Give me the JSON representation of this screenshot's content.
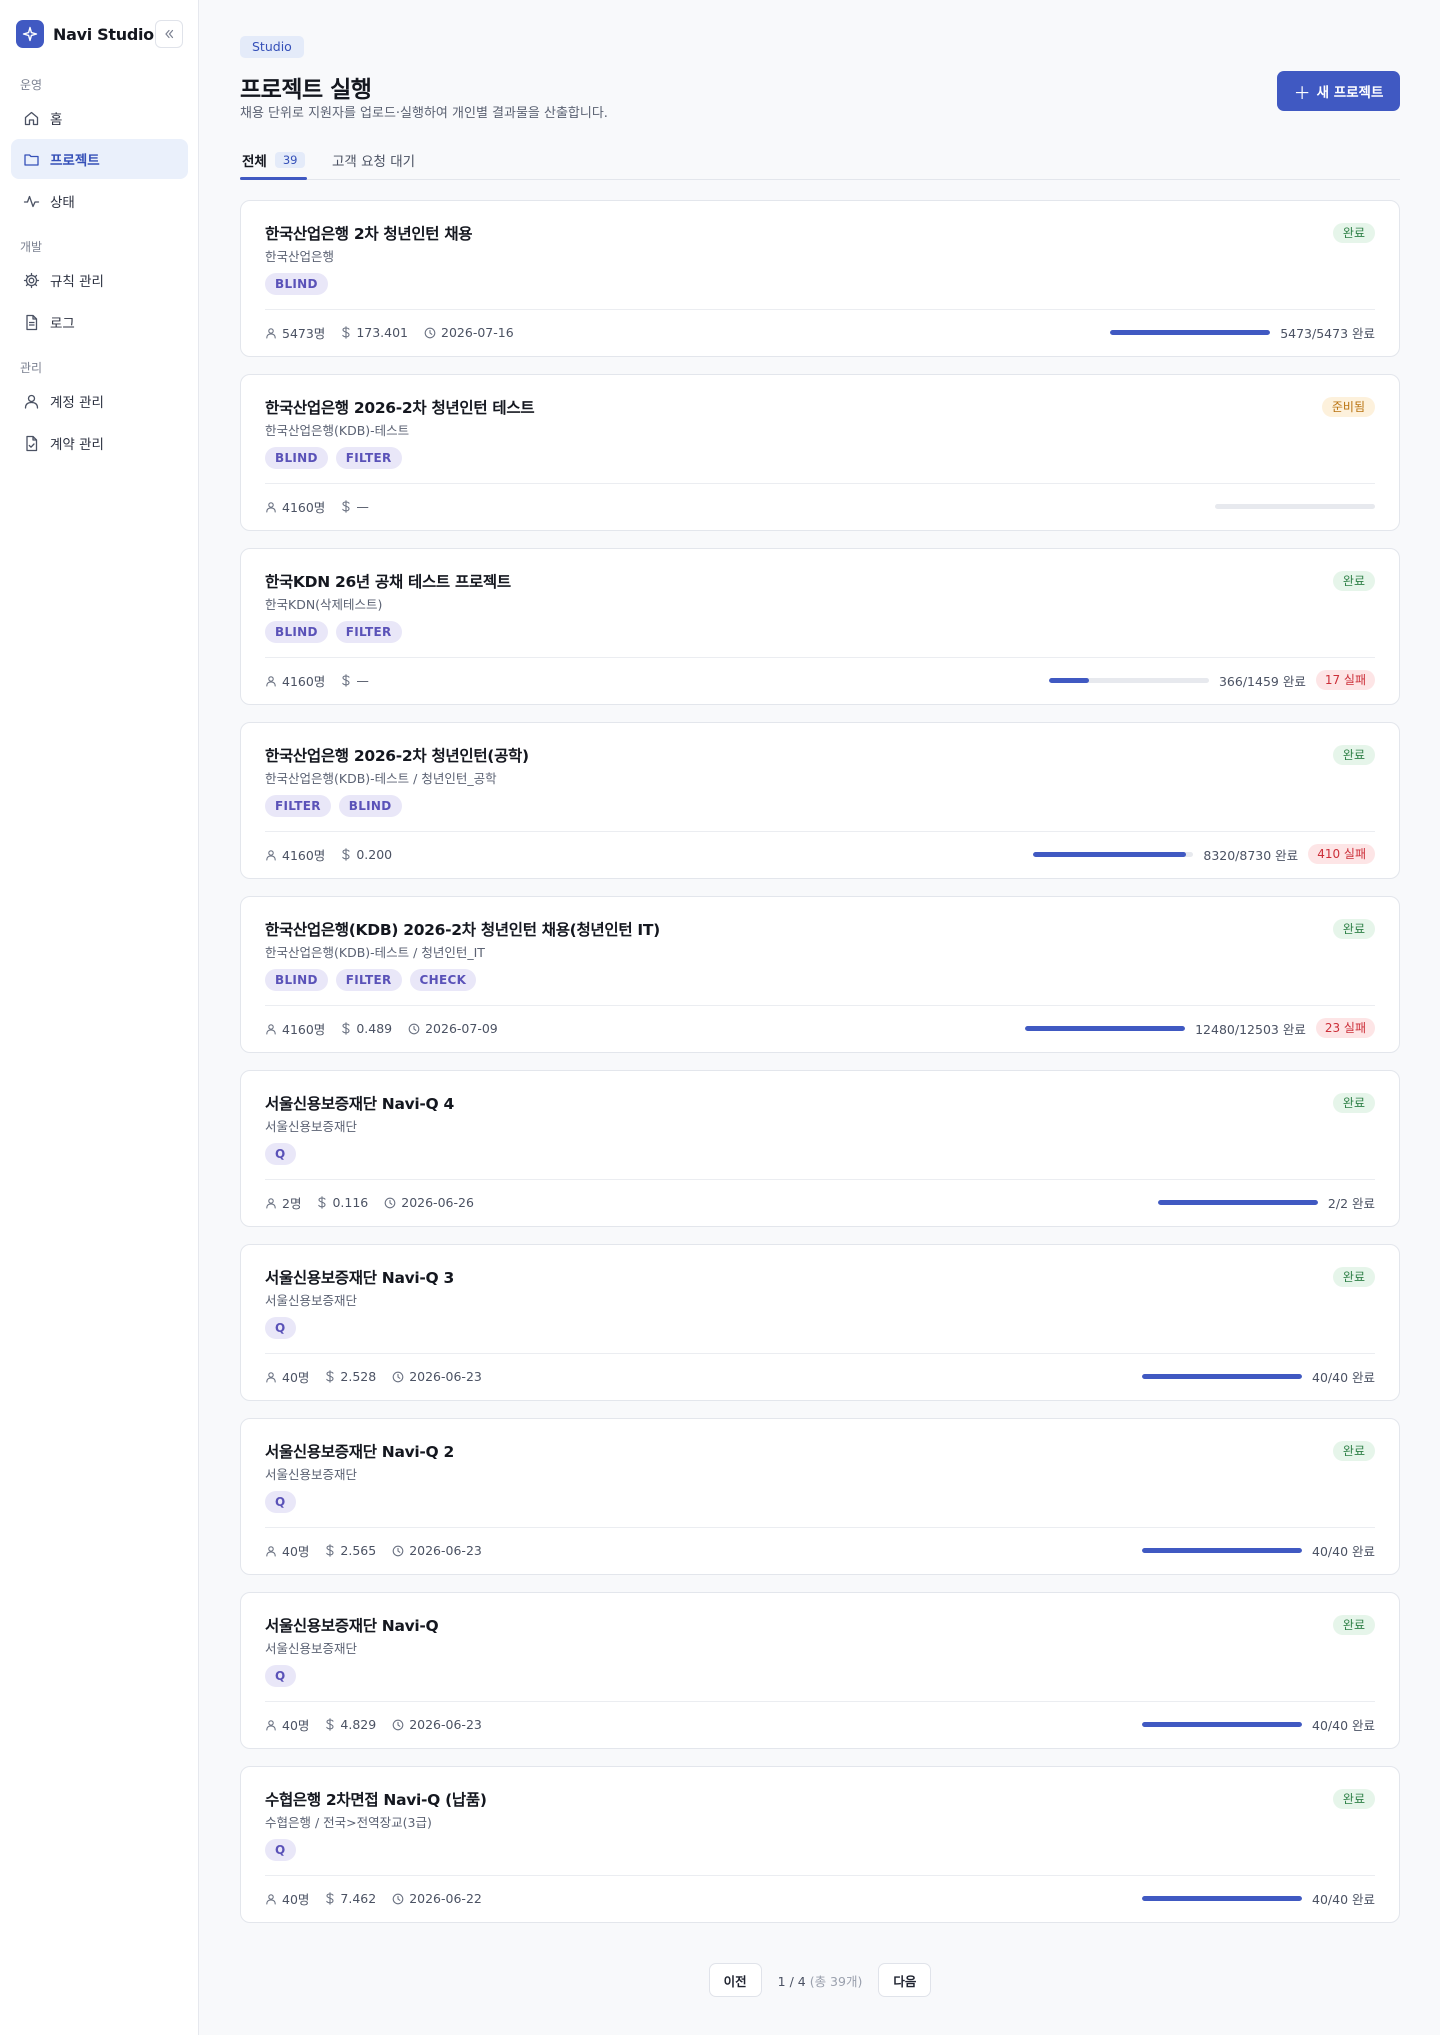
{
  "app": {
    "name": "Navi Studio"
  },
  "sidebar": {
    "sections": [
      {
        "label": "운영",
        "items": [
          {
            "label": "홈",
            "icon": "home-icon",
            "active": false
          },
          {
            "label": "프로젝트",
            "icon": "folder-icon",
            "active": true
          },
          {
            "label": "상태",
            "icon": "activity-icon",
            "active": false
          }
        ]
      },
      {
        "label": "개발",
        "items": [
          {
            "label": "규칙 관리",
            "icon": "gear-icon",
            "active": false
          },
          {
            "label": "로그",
            "icon": "document-icon",
            "active": false
          }
        ]
      },
      {
        "label": "관리",
        "items": [
          {
            "label": "계정 관리",
            "icon": "user-icon",
            "active": false
          },
          {
            "label": "계약 관리",
            "icon": "contract-icon",
            "active": false
          }
        ]
      }
    ]
  },
  "header": {
    "badge": "Studio",
    "title": "프로젝트 실행",
    "subtitle": "채용 단위로 지원자를 업로드·실행하여 개인별 결과물을 산출합니다.",
    "new_button": "새 프로젝트"
  },
  "tabs": [
    {
      "label": "전체",
      "count": "39",
      "active": true
    },
    {
      "label": "고객 요청 대기",
      "active": false
    }
  ],
  "projects": [
    {
      "title": "한국산업은행 2차 청년인턴 채용",
      "org": "한국산업은행",
      "status": "완료",
      "tags": [
        "BLIND"
      ],
      "people": "5473명",
      "cost": "173.401",
      "date": "2026-07-16",
      "progress": 1.0,
      "progress_text": "5473/5473 완료",
      "fail": ""
    },
    {
      "title": "한국산업은행 2026-2차 청년인턴 테스트",
      "org": "한국산업은행(KDB)-테스트",
      "status": "준비됨",
      "tags": [
        "BLIND",
        "FILTER"
      ],
      "people": "4160명",
      "cost": "—",
      "date": "",
      "progress": 0.0,
      "progress_text": "",
      "fail": ""
    },
    {
      "title": "한국KDN 26년 공채 테스트 프로젝트",
      "org": "한국KDN(삭제테스트)",
      "status": "완료",
      "tags": [
        "BLIND",
        "FILTER"
      ],
      "people": "4160명",
      "cost": "—",
      "date": "",
      "progress": 0.25,
      "progress_text": "366/1459 완료",
      "fail": "17 실패"
    },
    {
      "title": "한국산업은행 2026-2차 청년인턴(공학)",
      "org": "한국산업은행(KDB)-테스트 / 청년인턴_공학",
      "status": "완료",
      "tags": [
        "FILTER",
        "BLIND"
      ],
      "people": "4160명",
      "cost": "0.200",
      "date": "",
      "progress": 0.953,
      "progress_text": "8320/8730 완료",
      "fail": "410 실패"
    },
    {
      "title": "한국산업은행(KDB) 2026-2차 청년인턴 채용(청년인턴 IT)",
      "org": "한국산업은행(KDB)-테스트 / 청년인턴_IT",
      "status": "완료",
      "tags": [
        "BLIND",
        "FILTER",
        "CHECK"
      ],
      "people": "4160명",
      "cost": "0.489",
      "date": "2026-07-09",
      "progress": 0.998,
      "progress_text": "12480/12503 완료",
      "fail": "23 실패"
    },
    {
      "title": "서울신용보증재단 Navi-Q 4",
      "org": "서울신용보증재단",
      "status": "완료",
      "tags": [
        "Q"
      ],
      "people": "2명",
      "cost": "0.116",
      "date": "2026-06-26",
      "progress": 1.0,
      "progress_text": "2/2 완료",
      "fail": ""
    },
    {
      "title": "서울신용보증재단 Navi-Q 3",
      "org": "서울신용보증재단",
      "status": "완료",
      "tags": [
        "Q"
      ],
      "people": "40명",
      "cost": "2.528",
      "date": "2026-06-23",
      "progress": 1.0,
      "progress_text": "40/40 완료",
      "fail": ""
    },
    {
      "title": "서울신용보증재단 Navi-Q 2",
      "org": "서울신용보증재단",
      "status": "완료",
      "tags": [
        "Q"
      ],
      "people": "40명",
      "cost": "2.565",
      "date": "2026-06-23",
      "progress": 1.0,
      "progress_text": "40/40 완료",
      "fail": ""
    },
    {
      "title": "서울신용보증재단 Navi-Q",
      "org": "서울신용보증재단",
      "status": "완료",
      "tags": [
        "Q"
      ],
      "people": "40명",
      "cost": "4.829",
      "date": "2026-06-23",
      "progress": 1.0,
      "progress_text": "40/40 완료",
      "fail": ""
    },
    {
      "title": "수협은행 2차면접 Navi-Q (납품)",
      "org": "수협은행 / 전국>전역장교(3급)",
      "status": "완료",
      "tags": [
        "Q"
      ],
      "people": "40명",
      "cost": "7.462",
      "date": "2026-06-22",
      "progress": 1.0,
      "progress_text": "40/40 완료",
      "fail": ""
    }
  ],
  "pagination": {
    "prev": "이전",
    "current": "1 / 4",
    "total": "(총 39개)",
    "next": "다음"
  },
  "colors": {
    "accent": "#4059c2",
    "done_bg": "#e6f5ea",
    "done_fg": "#2f8047",
    "ready_bg": "#fdf1dc",
    "ready_fg": "#b9720f",
    "fail_bg": "#fde5e6",
    "fail_fg": "#cc2f39"
  }
}
